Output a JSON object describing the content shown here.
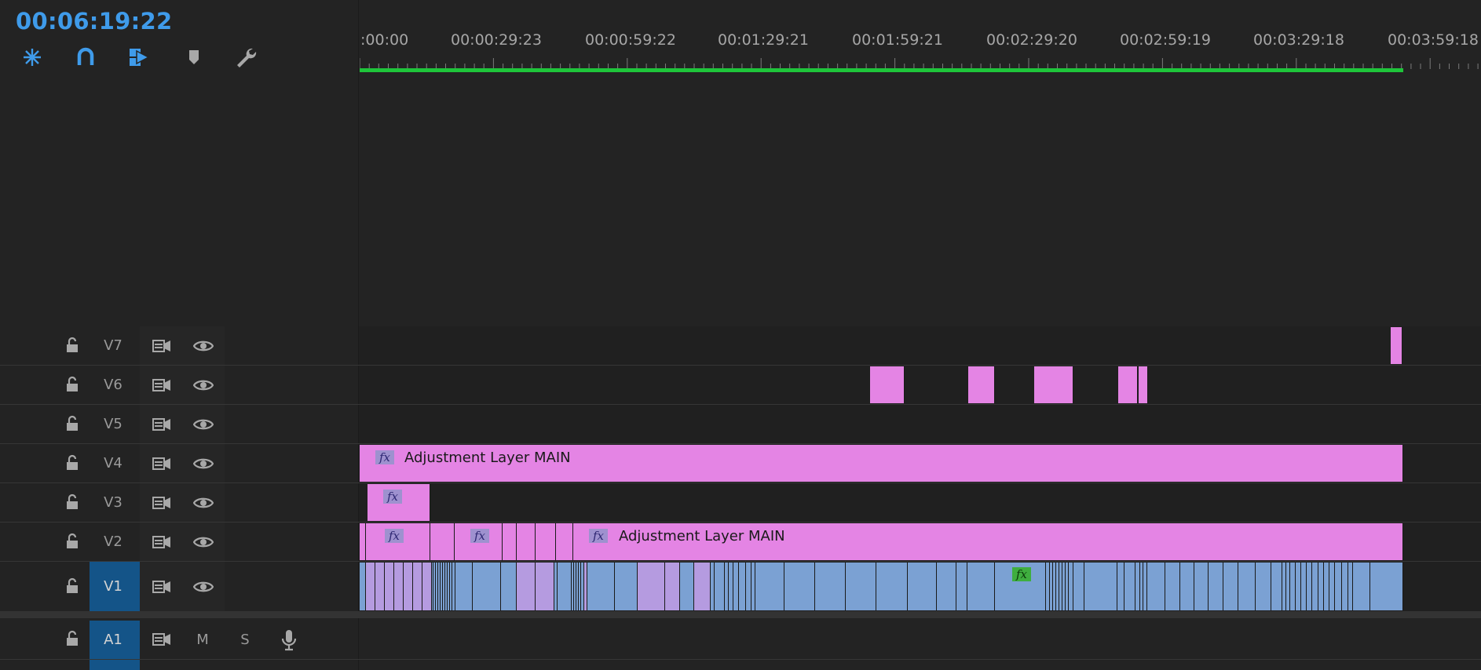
{
  "timecode": "00:06:19:22",
  "toolbar": {
    "tools": [
      {
        "name": "insert-overwrite-nest-icon"
      },
      {
        "name": "snap-icon"
      },
      {
        "name": "linked-selection-icon"
      },
      {
        "name": "add-marker-icon"
      },
      {
        "name": "timeline-settings-wrench-icon"
      }
    ]
  },
  "ruler": {
    "labels": [
      ":00:00",
      "00:00:29:23",
      "00:00:59:22",
      "00:01:29:21",
      "00:01:59:21",
      "00:02:29:20",
      "00:02:59:19",
      "00:03:29:18",
      "00:03:59:18"
    ]
  },
  "colors": {
    "accent": "#3f9bea",
    "clip_pink": "#e484e4",
    "clip_blue": "#7ba1d3",
    "workarea": "#1ec53a",
    "track_selected": "#145488"
  },
  "tracks": {
    "video": [
      {
        "id": "V7",
        "label": "V7"
      },
      {
        "id": "V6",
        "label": "V6"
      },
      {
        "id": "V5",
        "label": "V5"
      },
      {
        "id": "V4",
        "label": "V4"
      },
      {
        "id": "V3",
        "label": "V3"
      },
      {
        "id": "V2",
        "label": "V2"
      },
      {
        "id": "V1",
        "label": "V1",
        "selected": true
      }
    ],
    "audio": [
      {
        "id": "A1",
        "label": "A1",
        "selected": true,
        "mute": "M",
        "solo": "S"
      }
    ]
  },
  "clips": {
    "v4_label": "Adjustment Layer MAIN",
    "v2_label": "Adjustment Layer MAIN",
    "fx": "fx"
  }
}
